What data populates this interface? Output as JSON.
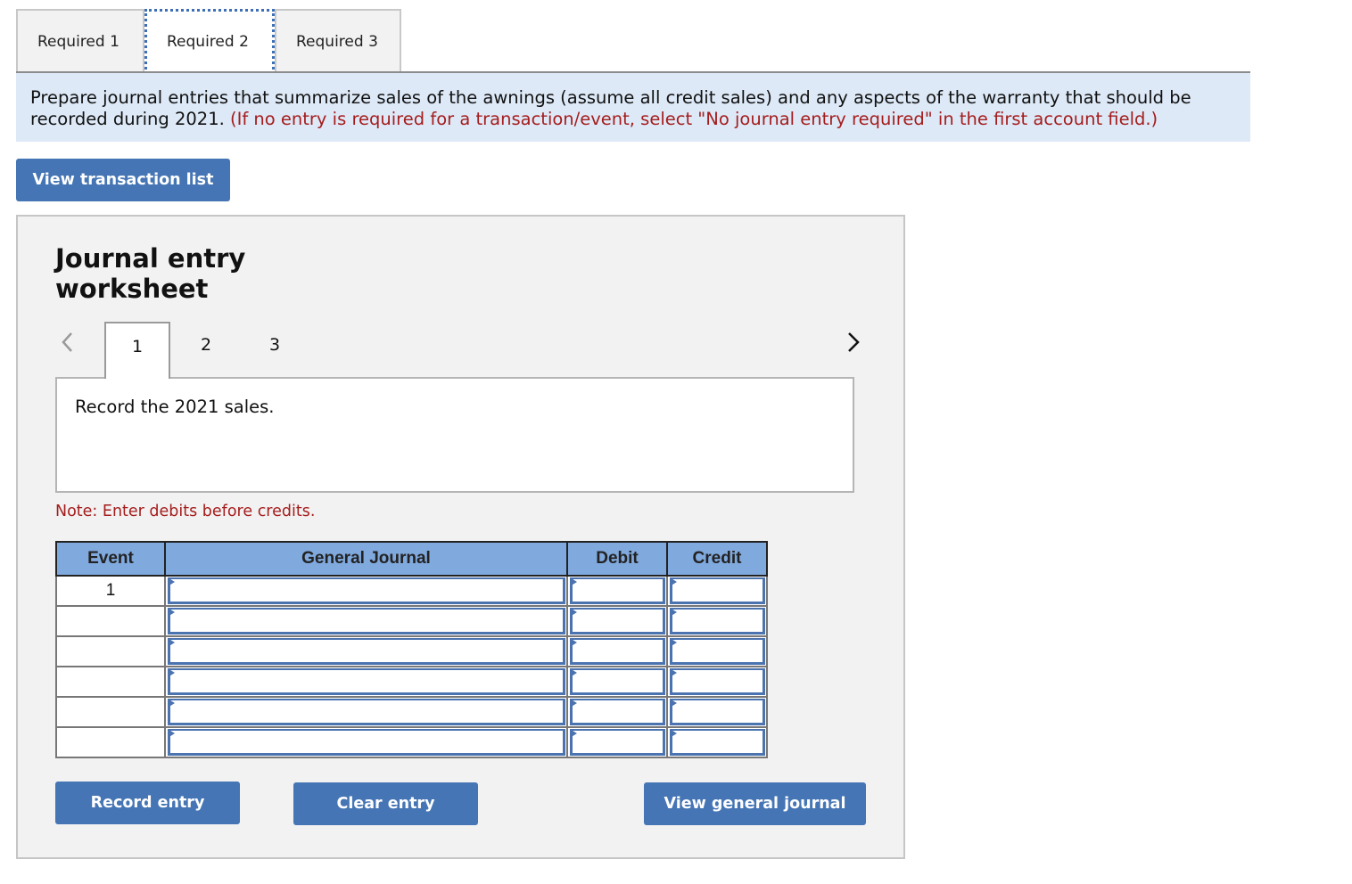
{
  "tabs": [
    {
      "label": "Required 1",
      "active": false
    },
    {
      "label": "Required 2",
      "active": true
    },
    {
      "label": "Required 3",
      "active": false
    }
  ],
  "instructions": {
    "text": "Prepare journal entries that summarize sales of the awnings (assume all credit sales) and any aspects of the warranty that should be recorded during 2021.",
    "note": "(If no entry is required for a transaction/event, select \"No journal entry required\" in the first account field.)"
  },
  "buttons": {
    "view_transaction_list": "View transaction list",
    "record_entry": "Record entry",
    "clear_entry": "Clear entry",
    "view_general_journal": "View general journal"
  },
  "worksheet": {
    "title_line1": "Journal entry",
    "title_line2": "worksheet",
    "pager": {
      "prev_icon": "chevron-left-icon",
      "next_icon": "chevron-right-icon",
      "pages": [
        "1",
        "2",
        "3"
      ],
      "current": "1"
    },
    "description": "Record the 2021 sales.",
    "note": "Note: Enter debits before credits.",
    "table": {
      "headers": [
        "Event",
        "General Journal",
        "Debit",
        "Credit"
      ],
      "rows": [
        {
          "event": "1",
          "account": "",
          "debit": "",
          "credit": ""
        },
        {
          "event": "",
          "account": "",
          "debit": "",
          "credit": ""
        },
        {
          "event": "",
          "account": "",
          "debit": "",
          "credit": ""
        },
        {
          "event": "",
          "account": "",
          "debit": "",
          "credit": ""
        },
        {
          "event": "",
          "account": "",
          "debit": "",
          "credit": ""
        },
        {
          "event": "",
          "account": "",
          "debit": "",
          "credit": ""
        }
      ]
    }
  },
  "colors": {
    "button_bg": "#4575b4",
    "header_bg": "#80a9de",
    "instruction_bg": "#dde9f7",
    "note_red": "#a51d1d",
    "panel_bg": "#f2f2f2"
  }
}
